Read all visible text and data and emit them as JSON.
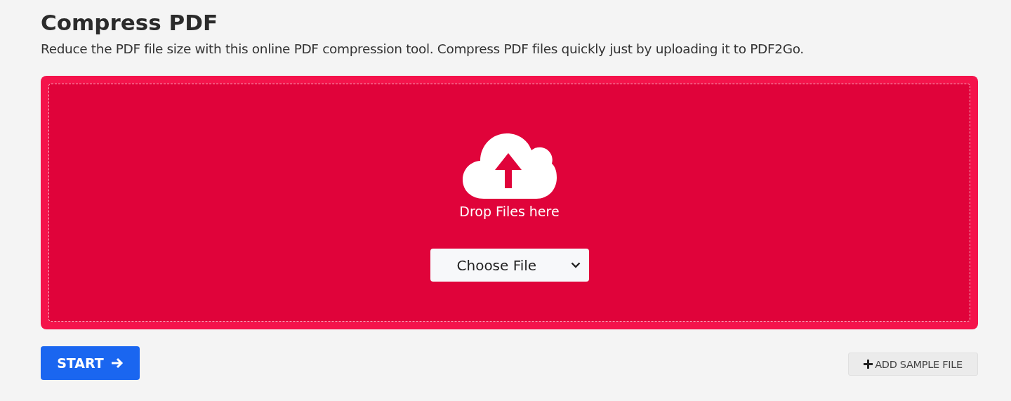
{
  "page": {
    "title": "Compress PDF",
    "description": "Reduce the PDF file size with this online PDF compression tool. Compress PDF files quickly just by uploading it to PDF2Go."
  },
  "dropzone": {
    "label": "Drop Files here",
    "choose_button": "Choose File"
  },
  "start_button": "START",
  "add_sample_button": "ADD SAMPLE FILE"
}
